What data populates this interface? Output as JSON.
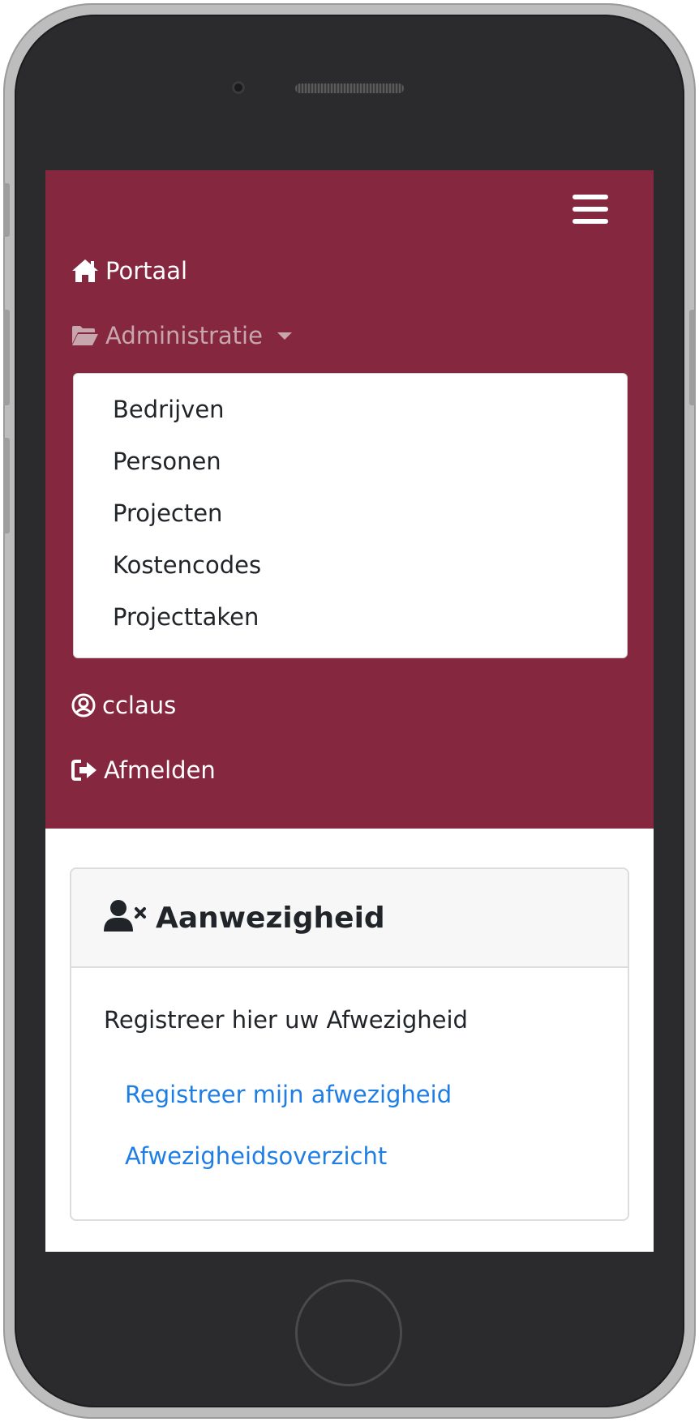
{
  "navbar": {
    "background_color": "#85273f",
    "toggle_icon": "hamburger-menu-icon",
    "portal": {
      "icon": "home-icon",
      "label": "Portaal"
    },
    "administration": {
      "icon": "folder-open-icon",
      "label": "Administratie",
      "expanded": true,
      "items": [
        {
          "label": "Bedrijven"
        },
        {
          "label": "Personen"
        },
        {
          "label": "Projecten"
        },
        {
          "label": "Kostencodes"
        },
        {
          "label": "Projecttaken"
        }
      ]
    },
    "user": {
      "icon": "user-circle-icon",
      "label": "cclaus"
    },
    "logout": {
      "icon": "sign-out-icon",
      "label": "Afmelden"
    }
  },
  "card": {
    "icon": "user-times-icon",
    "title": "Aanwezigheid",
    "description": "Registreer hier uw Afwezigheid",
    "links": [
      {
        "label": "Registreer mijn afwezigheid"
      },
      {
        "label": "Afwezigheidsoverzicht"
      }
    ],
    "link_color": "#1e7ee4"
  }
}
